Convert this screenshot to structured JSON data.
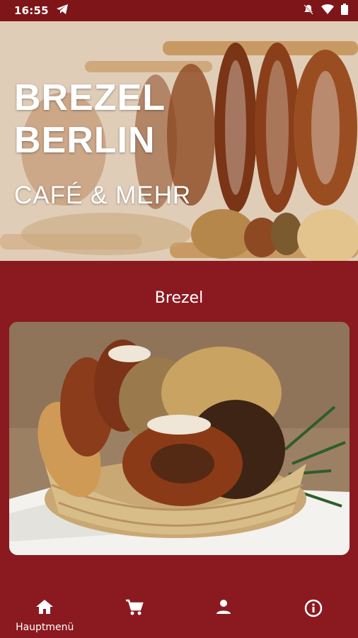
{
  "status_bar": {
    "time": "16:55",
    "icons": [
      "telegram-icon",
      "notifications-off-icon",
      "wifi-icon",
      "battery-icon"
    ]
  },
  "hero": {
    "title_line1": "BREZEL",
    "title_line2": "BERLIN",
    "subtitle": "CAFÉ & MEHR"
  },
  "section": {
    "title": "Brezel"
  },
  "bottom_nav": {
    "items": [
      {
        "label": "Hauptmenü",
        "icon": "home-icon"
      },
      {
        "label": "",
        "icon": "cart-icon"
      },
      {
        "label": "",
        "icon": "person-icon"
      },
      {
        "label": "",
        "icon": "info-icon"
      }
    ]
  },
  "colors": {
    "background": "#8a1a20",
    "status_bar": "#7d1519",
    "text": "#ffffff"
  }
}
